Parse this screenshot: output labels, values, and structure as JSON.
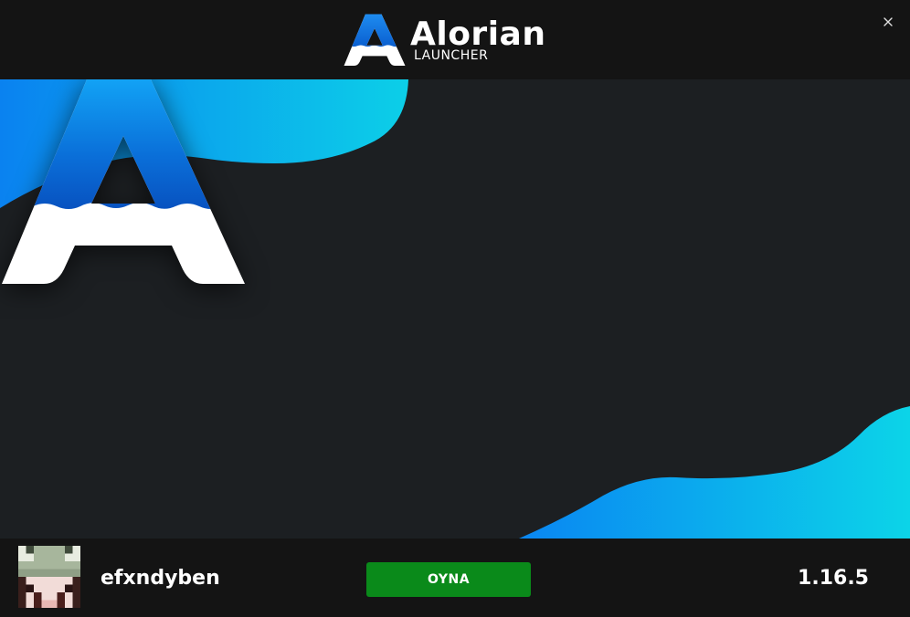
{
  "titlebar": {
    "brand_name": "Alorian",
    "brand_sub": "LAUNCHER",
    "close_icon": "close-icon"
  },
  "hero": {
    "logo_icon": "alorian-a-logo",
    "accent_colors": [
      "#0a82f0",
      "#0cd2e8"
    ]
  },
  "footer": {
    "avatar_icon": "player-skin-avatar",
    "username": "efxndyben",
    "play_label": "OYNA",
    "version": "1.16.5",
    "play_color": "#0a8a1a"
  }
}
